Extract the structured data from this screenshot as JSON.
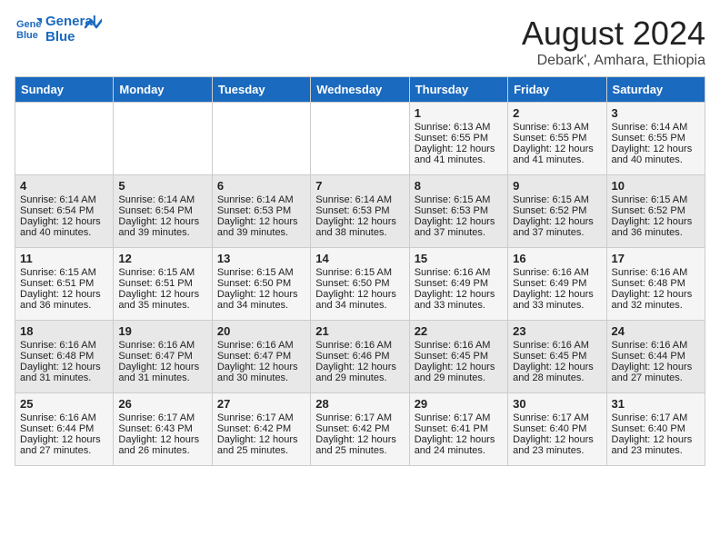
{
  "header": {
    "logo_line1": "General",
    "logo_line2": "Blue",
    "month": "August 2024",
    "location": "Debark', Amhara, Ethiopia"
  },
  "weekdays": [
    "Sunday",
    "Monday",
    "Tuesday",
    "Wednesday",
    "Thursday",
    "Friday",
    "Saturday"
  ],
  "weeks": [
    [
      {
        "day": "",
        "info": ""
      },
      {
        "day": "",
        "info": ""
      },
      {
        "day": "",
        "info": ""
      },
      {
        "day": "",
        "info": ""
      },
      {
        "day": "1",
        "info": "Sunrise: 6:13 AM\nSunset: 6:55 PM\nDaylight: 12 hours and 41 minutes."
      },
      {
        "day": "2",
        "info": "Sunrise: 6:13 AM\nSunset: 6:55 PM\nDaylight: 12 hours and 41 minutes."
      },
      {
        "day": "3",
        "info": "Sunrise: 6:14 AM\nSunset: 6:55 PM\nDaylight: 12 hours and 40 minutes."
      }
    ],
    [
      {
        "day": "4",
        "info": "Sunrise: 6:14 AM\nSunset: 6:54 PM\nDaylight: 12 hours and 40 minutes."
      },
      {
        "day": "5",
        "info": "Sunrise: 6:14 AM\nSunset: 6:54 PM\nDaylight: 12 hours and 39 minutes."
      },
      {
        "day": "6",
        "info": "Sunrise: 6:14 AM\nSunset: 6:53 PM\nDaylight: 12 hours and 39 minutes."
      },
      {
        "day": "7",
        "info": "Sunrise: 6:14 AM\nSunset: 6:53 PM\nDaylight: 12 hours and 38 minutes."
      },
      {
        "day": "8",
        "info": "Sunrise: 6:15 AM\nSunset: 6:53 PM\nDaylight: 12 hours and 37 minutes."
      },
      {
        "day": "9",
        "info": "Sunrise: 6:15 AM\nSunset: 6:52 PM\nDaylight: 12 hours and 37 minutes."
      },
      {
        "day": "10",
        "info": "Sunrise: 6:15 AM\nSunset: 6:52 PM\nDaylight: 12 hours and 36 minutes."
      }
    ],
    [
      {
        "day": "11",
        "info": "Sunrise: 6:15 AM\nSunset: 6:51 PM\nDaylight: 12 hours and 36 minutes."
      },
      {
        "day": "12",
        "info": "Sunrise: 6:15 AM\nSunset: 6:51 PM\nDaylight: 12 hours and 35 minutes."
      },
      {
        "day": "13",
        "info": "Sunrise: 6:15 AM\nSunset: 6:50 PM\nDaylight: 12 hours and 34 minutes."
      },
      {
        "day": "14",
        "info": "Sunrise: 6:15 AM\nSunset: 6:50 PM\nDaylight: 12 hours and 34 minutes."
      },
      {
        "day": "15",
        "info": "Sunrise: 6:16 AM\nSunset: 6:49 PM\nDaylight: 12 hours and 33 minutes."
      },
      {
        "day": "16",
        "info": "Sunrise: 6:16 AM\nSunset: 6:49 PM\nDaylight: 12 hours and 33 minutes."
      },
      {
        "day": "17",
        "info": "Sunrise: 6:16 AM\nSunset: 6:48 PM\nDaylight: 12 hours and 32 minutes."
      }
    ],
    [
      {
        "day": "18",
        "info": "Sunrise: 6:16 AM\nSunset: 6:48 PM\nDaylight: 12 hours and 31 minutes."
      },
      {
        "day": "19",
        "info": "Sunrise: 6:16 AM\nSunset: 6:47 PM\nDaylight: 12 hours and 31 minutes."
      },
      {
        "day": "20",
        "info": "Sunrise: 6:16 AM\nSunset: 6:47 PM\nDaylight: 12 hours and 30 minutes."
      },
      {
        "day": "21",
        "info": "Sunrise: 6:16 AM\nSunset: 6:46 PM\nDaylight: 12 hours and 29 minutes."
      },
      {
        "day": "22",
        "info": "Sunrise: 6:16 AM\nSunset: 6:45 PM\nDaylight: 12 hours and 29 minutes."
      },
      {
        "day": "23",
        "info": "Sunrise: 6:16 AM\nSunset: 6:45 PM\nDaylight: 12 hours and 28 minutes."
      },
      {
        "day": "24",
        "info": "Sunrise: 6:16 AM\nSunset: 6:44 PM\nDaylight: 12 hours and 27 minutes."
      }
    ],
    [
      {
        "day": "25",
        "info": "Sunrise: 6:16 AM\nSunset: 6:44 PM\nDaylight: 12 hours and 27 minutes."
      },
      {
        "day": "26",
        "info": "Sunrise: 6:17 AM\nSunset: 6:43 PM\nDaylight: 12 hours and 26 minutes."
      },
      {
        "day": "27",
        "info": "Sunrise: 6:17 AM\nSunset: 6:42 PM\nDaylight: 12 hours and 25 minutes."
      },
      {
        "day": "28",
        "info": "Sunrise: 6:17 AM\nSunset: 6:42 PM\nDaylight: 12 hours and 25 minutes."
      },
      {
        "day": "29",
        "info": "Sunrise: 6:17 AM\nSunset: 6:41 PM\nDaylight: 12 hours and 24 minutes."
      },
      {
        "day": "30",
        "info": "Sunrise: 6:17 AM\nSunset: 6:40 PM\nDaylight: 12 hours and 23 minutes."
      },
      {
        "day": "31",
        "info": "Sunrise: 6:17 AM\nSunset: 6:40 PM\nDaylight: 12 hours and 23 minutes."
      }
    ]
  ]
}
